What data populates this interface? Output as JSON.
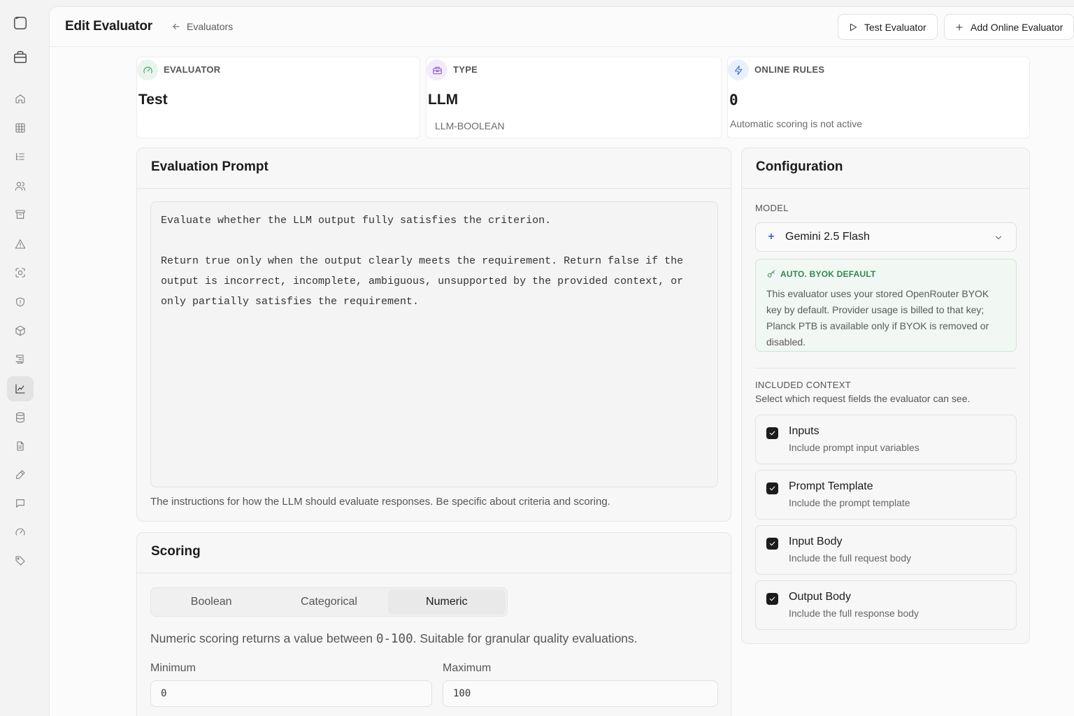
{
  "header": {
    "title": "Edit Evaluator",
    "back_label": "Evaluators",
    "test_button": "Test Evaluator",
    "add_online_button": "Add Online Evaluator"
  },
  "stats": [
    {
      "label": "EVALUATOR",
      "value": "Test",
      "sub": "",
      "icon": "gauge-icon",
      "color": "#3f9b64"
    },
    {
      "label": "TYPE",
      "value": "LLM",
      "sub": "LLM-BOOLEAN",
      "icon": "toolbox-icon",
      "color": "#8a4fc9"
    },
    {
      "label": "ONLINE RULES",
      "value": "0",
      "sub": "Automatic scoring is not active",
      "icon": "activity-icon",
      "color": "#3a6fd6"
    }
  ],
  "prompt": {
    "title": "Evaluation Prompt",
    "text": "Evaluate whether the LLM output fully satisfies the criterion.\n\nReturn true only when the output clearly meets the requirement. Return false if the\noutput is incorrect, incomplete, ambiguous, unsupported by the provided context, or\nonly partially satisfies the requirement.",
    "help": "The instructions for how the LLM should evaluate responses. Be specific about criteria and scoring."
  },
  "scoring": {
    "title": "Scoring",
    "tabs": [
      "Boolean",
      "Categorical",
      "Numeric"
    ],
    "active_tab": "Numeric",
    "desc_prefix": "Numeric scoring returns a value between ",
    "desc_range": "0-100",
    "desc_suffix": ". Suitable for granular quality evaluations.",
    "min_label": "Minimum",
    "min_value": "0",
    "max_label": "Maximum",
    "max_value": "100"
  },
  "config": {
    "title": "Configuration",
    "model_label": "MODEL",
    "model_value": "Gemini 2.5 Flash",
    "byok_title": "AUTO. BYOK DEFAULT",
    "byok_text": "This evaluator uses your stored OpenRouter BYOK key by default. Provider usage is billed to that key; Planck PTB is available only if BYOK is removed or disabled.",
    "context_label": "INCLUDED CONTEXT",
    "context_sub": "Select which request fields the evaluator can see.",
    "context_items": [
      {
        "title": "Inputs",
        "desc": "Include prompt input variables",
        "checked": true
      },
      {
        "title": "Prompt Template",
        "desc": "Include the prompt template",
        "checked": true
      },
      {
        "title": "Input Body",
        "desc": "Include the full request body",
        "checked": true
      },
      {
        "title": "Output Body",
        "desc": "Include the full response body",
        "checked": true
      }
    ]
  },
  "sidebar": {
    "active_item": "charts-icon",
    "items": [
      "home-icon",
      "table-icon",
      "list-icon",
      "users-icon",
      "archive-icon",
      "alert-icon",
      "scan-icon",
      "shield-icon",
      "cube-icon",
      "scroll-icon",
      "charts-icon",
      "database-icon",
      "document-icon",
      "pen-icon",
      "chat-icon",
      "gauge-icon",
      "tag-icon"
    ]
  }
}
